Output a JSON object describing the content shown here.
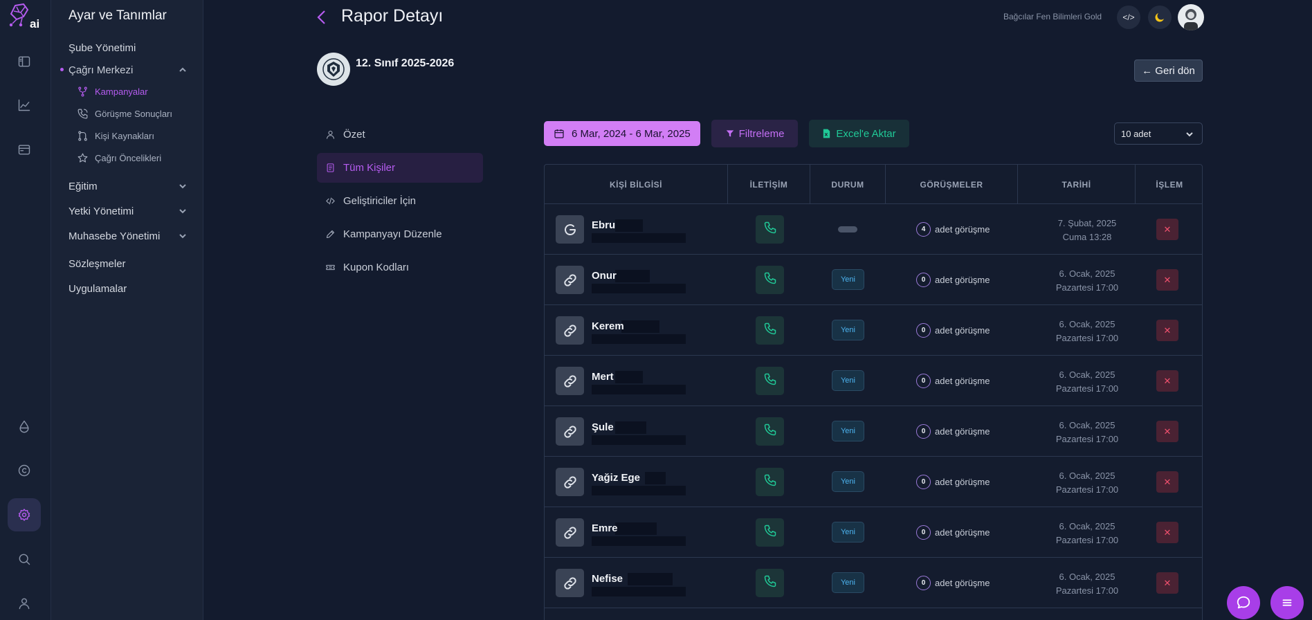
{
  "menu": {
    "title": "Ayar ve Tanımlar",
    "items": [
      {
        "label": "Şube Yönetimi"
      },
      {
        "label": "Çağrı Merkezi"
      },
      {
        "label": "Eğitim"
      },
      {
        "label": "Yetki Yönetimi"
      },
      {
        "label": "Muhasebe Yönetimi"
      },
      {
        "label": "Sözleşmeler"
      },
      {
        "label": "Uygulamalar"
      }
    ],
    "subitems": [
      {
        "label": "Kampanyalar",
        "icon": "branch-icon"
      },
      {
        "label": "Görüşme Sonuçları",
        "icon": "phone-call-icon"
      },
      {
        "label": "Kişi Kaynakları",
        "icon": "git-flow-icon"
      },
      {
        "label": "Çağrı Öncelikleri",
        "icon": "star-icon"
      }
    ]
  },
  "header": {
    "title": "Rapor Detayı",
    "school": "Bağcılar Fen Bilimleri Gold",
    "code_label": "</>"
  },
  "campaign": {
    "name": "12. Sınıf 2025-2026",
    "back_label": "← Geri dön"
  },
  "tabs": [
    {
      "label": "Özet"
    },
    {
      "label": "Tüm Kişiler"
    },
    {
      "label": "Geliştiriciler İçin"
    },
    {
      "label": "Kampanyayı Düzenle"
    },
    {
      "label": "Kupon Kodları"
    }
  ],
  "toolbar": {
    "date_range": "6 Mar, 2024 - 6 Mar, 2025",
    "filter_label": "Filtreleme",
    "excel_label": "Excel'e Aktar",
    "page_size": "10 adet"
  },
  "table": {
    "columns": [
      "KİŞİ BİLGİSİ",
      "İLETİŞİM",
      "DURUM",
      "GÖRÜŞMELER",
      "TARİHİ",
      "İŞLEM"
    ],
    "rows": [
      {
        "name": "Ebru",
        "source": "google",
        "status": "",
        "count": "4",
        "meetings": "adet görüşme",
        "date1": "7. Şubat, 2025",
        "date2": "Cuma 13:28"
      },
      {
        "name": "Onur",
        "source": "link",
        "status": "Yeni",
        "count": "0",
        "meetings": "adet görüşme",
        "date1": "6. Ocak, 2025",
        "date2": "Pazartesi 17:00"
      },
      {
        "name": "Kerem",
        "source": "link",
        "status": "Yeni",
        "count": "0",
        "meetings": "adet görüşme",
        "date1": "6. Ocak, 2025",
        "date2": "Pazartesi 17:00"
      },
      {
        "name": "Mert",
        "source": "link",
        "status": "Yeni",
        "count": "0",
        "meetings": "adet görüşme",
        "date1": "6. Ocak, 2025",
        "date2": "Pazartesi 17:00"
      },
      {
        "name": "Şule",
        "source": "link",
        "status": "Yeni",
        "count": "0",
        "meetings": "adet görüşme",
        "date1": "6. Ocak, 2025",
        "date2": "Pazartesi 17:00"
      },
      {
        "name": "Yağiz Ege",
        "source": "link",
        "status": "Yeni",
        "count": "0",
        "meetings": "adet görüşme",
        "date1": "6. Ocak, 2025",
        "date2": "Pazartesi 17:00"
      },
      {
        "name": "Emre",
        "source": "link",
        "status": "Yeni",
        "count": "0",
        "meetings": "adet görüşme",
        "date1": "6. Ocak, 2025",
        "date2": "Pazartesi 17:00"
      },
      {
        "name": "Nefise",
        "source": "link",
        "status": "Yeni",
        "count": "0",
        "meetings": "adet görüşme",
        "date1": "6. Ocak, 2025",
        "date2": "Pazartesi 17:00"
      }
    ]
  },
  "colors": {
    "accent": "#b65cf0",
    "success": "#20c997",
    "danger": "#f0506e",
    "background": "#131b2e"
  }
}
